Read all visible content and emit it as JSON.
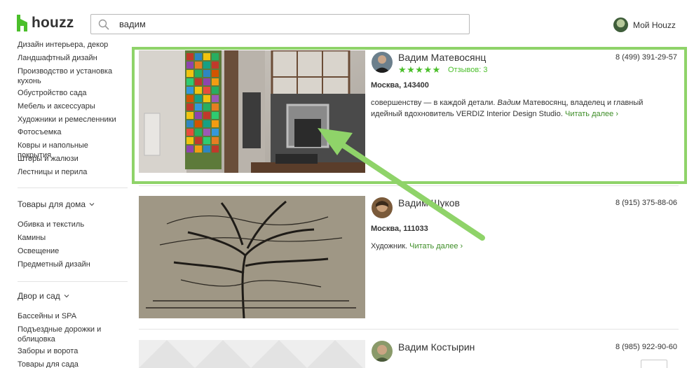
{
  "header": {
    "logo_text": "houzz",
    "search_value": "вадим",
    "user_label": "Мой Houzz"
  },
  "sidebar": {
    "group1": [
      "Дизайн интерьера, декор",
      "Ландшафтный дизайн",
      "Производство и установка кухонь",
      "Обустройство сада",
      "Мебель и аксессуары",
      "Художники и ремесленники",
      "Фотосъемка",
      "Ковры и напольные покрытия",
      "Шторы и жалюзи",
      "Лестницы и перила"
    ],
    "heading2": "Товары для дома",
    "group2": [
      "Обивка и текстиль",
      "Камины",
      "Освещение",
      "Предметный дизайн"
    ],
    "heading3": "Двор и сад",
    "group3": [
      "Бассейны и SPA",
      "Подъездные дорожки и облицовка",
      "Заборы и ворота",
      "Товары для сада"
    ]
  },
  "listings": [
    {
      "name": "Вадим Матевосянц",
      "phone": "8 (499) 391-29-57",
      "stars": "★★★★★",
      "reviews": "Отзывов: 3",
      "city": "Москва, 143400",
      "desc_a": "совершенству — в каждой детали. ",
      "desc_em": "Вадим",
      "desc_b": " Матевосянц, владелец и главный идейный вдохновитель VERDIZ Interior Design Studio. ",
      "more": "Читать далее ›"
    },
    {
      "name": "Вадим Шуков",
      "phone": "8 (915) 375-88-06",
      "city": "Москва, 111033",
      "desc_a": "Художник. ",
      "more": "Читать далее ›"
    },
    {
      "name": "Вадим Костырин",
      "phone": "8 (985) 922-90-60"
    }
  ],
  "colors": {
    "accent_green": "#4bbf2b",
    "highlight_green": "#8fd369",
    "link_green": "#3d8d26"
  }
}
